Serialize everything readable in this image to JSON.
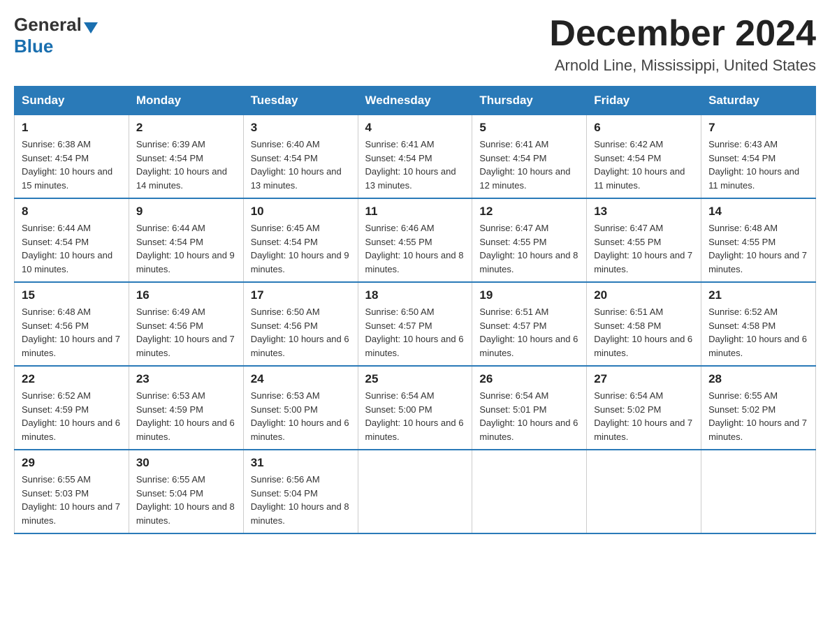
{
  "header": {
    "logo": {
      "general": "General",
      "arrow": "▶",
      "blue": "Blue"
    },
    "title": "December 2024",
    "subtitle": "Arnold Line, Mississippi, United States"
  },
  "calendar": {
    "days_of_week": [
      "Sunday",
      "Monday",
      "Tuesday",
      "Wednesday",
      "Thursday",
      "Friday",
      "Saturday"
    ],
    "weeks": [
      [
        {
          "day": "1",
          "sunrise": "Sunrise: 6:38 AM",
          "sunset": "Sunset: 4:54 PM",
          "daylight": "Daylight: 10 hours and 15 minutes."
        },
        {
          "day": "2",
          "sunrise": "Sunrise: 6:39 AM",
          "sunset": "Sunset: 4:54 PM",
          "daylight": "Daylight: 10 hours and 14 minutes."
        },
        {
          "day": "3",
          "sunrise": "Sunrise: 6:40 AM",
          "sunset": "Sunset: 4:54 PM",
          "daylight": "Daylight: 10 hours and 13 minutes."
        },
        {
          "day": "4",
          "sunrise": "Sunrise: 6:41 AM",
          "sunset": "Sunset: 4:54 PM",
          "daylight": "Daylight: 10 hours and 13 minutes."
        },
        {
          "day": "5",
          "sunrise": "Sunrise: 6:41 AM",
          "sunset": "Sunset: 4:54 PM",
          "daylight": "Daylight: 10 hours and 12 minutes."
        },
        {
          "day": "6",
          "sunrise": "Sunrise: 6:42 AM",
          "sunset": "Sunset: 4:54 PM",
          "daylight": "Daylight: 10 hours and 11 minutes."
        },
        {
          "day": "7",
          "sunrise": "Sunrise: 6:43 AM",
          "sunset": "Sunset: 4:54 PM",
          "daylight": "Daylight: 10 hours and 11 minutes."
        }
      ],
      [
        {
          "day": "8",
          "sunrise": "Sunrise: 6:44 AM",
          "sunset": "Sunset: 4:54 PM",
          "daylight": "Daylight: 10 hours and 10 minutes."
        },
        {
          "day": "9",
          "sunrise": "Sunrise: 6:44 AM",
          "sunset": "Sunset: 4:54 PM",
          "daylight": "Daylight: 10 hours and 9 minutes."
        },
        {
          "day": "10",
          "sunrise": "Sunrise: 6:45 AM",
          "sunset": "Sunset: 4:54 PM",
          "daylight": "Daylight: 10 hours and 9 minutes."
        },
        {
          "day": "11",
          "sunrise": "Sunrise: 6:46 AM",
          "sunset": "Sunset: 4:55 PM",
          "daylight": "Daylight: 10 hours and 8 minutes."
        },
        {
          "day": "12",
          "sunrise": "Sunrise: 6:47 AM",
          "sunset": "Sunset: 4:55 PM",
          "daylight": "Daylight: 10 hours and 8 minutes."
        },
        {
          "day": "13",
          "sunrise": "Sunrise: 6:47 AM",
          "sunset": "Sunset: 4:55 PM",
          "daylight": "Daylight: 10 hours and 7 minutes."
        },
        {
          "day": "14",
          "sunrise": "Sunrise: 6:48 AM",
          "sunset": "Sunset: 4:55 PM",
          "daylight": "Daylight: 10 hours and 7 minutes."
        }
      ],
      [
        {
          "day": "15",
          "sunrise": "Sunrise: 6:48 AM",
          "sunset": "Sunset: 4:56 PM",
          "daylight": "Daylight: 10 hours and 7 minutes."
        },
        {
          "day": "16",
          "sunrise": "Sunrise: 6:49 AM",
          "sunset": "Sunset: 4:56 PM",
          "daylight": "Daylight: 10 hours and 7 minutes."
        },
        {
          "day": "17",
          "sunrise": "Sunrise: 6:50 AM",
          "sunset": "Sunset: 4:56 PM",
          "daylight": "Daylight: 10 hours and 6 minutes."
        },
        {
          "day": "18",
          "sunrise": "Sunrise: 6:50 AM",
          "sunset": "Sunset: 4:57 PM",
          "daylight": "Daylight: 10 hours and 6 minutes."
        },
        {
          "day": "19",
          "sunrise": "Sunrise: 6:51 AM",
          "sunset": "Sunset: 4:57 PM",
          "daylight": "Daylight: 10 hours and 6 minutes."
        },
        {
          "day": "20",
          "sunrise": "Sunrise: 6:51 AM",
          "sunset": "Sunset: 4:58 PM",
          "daylight": "Daylight: 10 hours and 6 minutes."
        },
        {
          "day": "21",
          "sunrise": "Sunrise: 6:52 AM",
          "sunset": "Sunset: 4:58 PM",
          "daylight": "Daylight: 10 hours and 6 minutes."
        }
      ],
      [
        {
          "day": "22",
          "sunrise": "Sunrise: 6:52 AM",
          "sunset": "Sunset: 4:59 PM",
          "daylight": "Daylight: 10 hours and 6 minutes."
        },
        {
          "day": "23",
          "sunrise": "Sunrise: 6:53 AM",
          "sunset": "Sunset: 4:59 PM",
          "daylight": "Daylight: 10 hours and 6 minutes."
        },
        {
          "day": "24",
          "sunrise": "Sunrise: 6:53 AM",
          "sunset": "Sunset: 5:00 PM",
          "daylight": "Daylight: 10 hours and 6 minutes."
        },
        {
          "day": "25",
          "sunrise": "Sunrise: 6:54 AM",
          "sunset": "Sunset: 5:00 PM",
          "daylight": "Daylight: 10 hours and 6 minutes."
        },
        {
          "day": "26",
          "sunrise": "Sunrise: 6:54 AM",
          "sunset": "Sunset: 5:01 PM",
          "daylight": "Daylight: 10 hours and 6 minutes."
        },
        {
          "day": "27",
          "sunrise": "Sunrise: 6:54 AM",
          "sunset": "Sunset: 5:02 PM",
          "daylight": "Daylight: 10 hours and 7 minutes."
        },
        {
          "day": "28",
          "sunrise": "Sunrise: 6:55 AM",
          "sunset": "Sunset: 5:02 PM",
          "daylight": "Daylight: 10 hours and 7 minutes."
        }
      ],
      [
        {
          "day": "29",
          "sunrise": "Sunrise: 6:55 AM",
          "sunset": "Sunset: 5:03 PM",
          "daylight": "Daylight: 10 hours and 7 minutes."
        },
        {
          "day": "30",
          "sunrise": "Sunrise: 6:55 AM",
          "sunset": "Sunset: 5:04 PM",
          "daylight": "Daylight: 10 hours and 8 minutes."
        },
        {
          "day": "31",
          "sunrise": "Sunrise: 6:56 AM",
          "sunset": "Sunset: 5:04 PM",
          "daylight": "Daylight: 10 hours and 8 minutes."
        },
        null,
        null,
        null,
        null
      ]
    ]
  }
}
